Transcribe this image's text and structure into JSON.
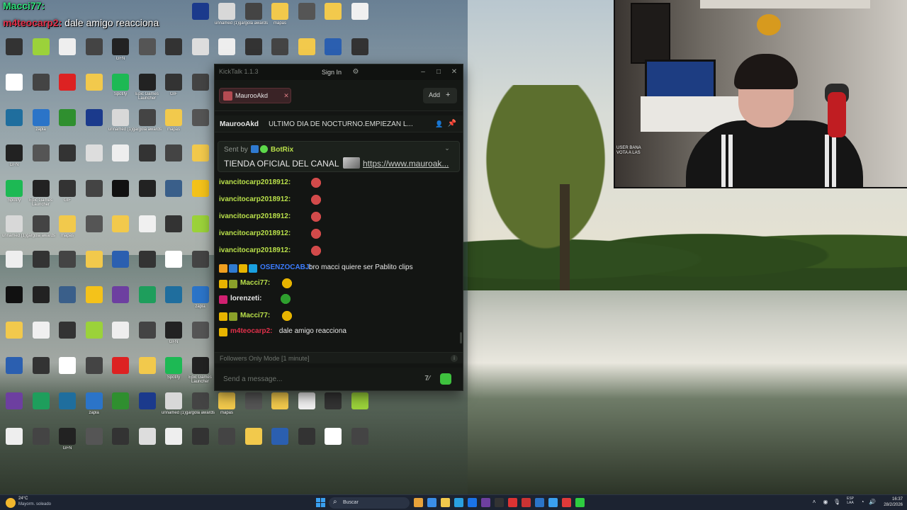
{
  "overlay_chat": [
    {
      "user": "Macci77:",
      "user_color": "#2ee07a",
      "text": ""
    },
    {
      "user": "m4teocarp2:",
      "user_color": "#e0304a",
      "text": "dale amigo reacciona"
    }
  ],
  "desktop_icons": [
    {
      "label": "",
      "color": "#3a5f8a"
    },
    {
      "label": "",
      "color": "#f4c21a"
    },
    {
      "label": "",
      "color": "#6d3fa0"
    },
    {
      "label": "",
      "color": "#1e9e5c"
    },
    {
      "label": "",
      "color": "#1f6e9e"
    },
    {
      "label": "zapla",
      "color": "#2b74c8"
    },
    {
      "label": "",
      "color": "#2f8f2f"
    },
    {
      "label": "",
      "color": "#1b3a8c"
    },
    {
      "label": "unnamed (1)",
      "color": "#d8d8d8"
    },
    {
      "label": "gargola awards",
      "color": "#444"
    },
    {
      "label": "mapas",
      "color": "#f2c94c"
    },
    {
      "label": "",
      "color": "#555"
    },
    {
      "label": "",
      "color": "#f2c94c"
    },
    {
      "label": "",
      "color": "#f0f0f0"
    },
    {
      "label": "",
      "color": "#333"
    },
    {
      "label": "",
      "color": "#9bd23a"
    },
    {
      "label": "",
      "color": "#eee"
    },
    {
      "label": "",
      "color": "#444"
    },
    {
      "label": "GFN",
      "color": "#222"
    },
    {
      "label": "",
      "color": "#555"
    },
    {
      "label": "",
      "color": "#333"
    },
    {
      "label": "",
      "color": "#ddd"
    },
    {
      "label": "",
      "color": "#eee"
    },
    {
      "label": "",
      "color": "#333"
    },
    {
      "label": "",
      "color": "#444"
    },
    {
      "label": "",
      "color": "#f2c94c"
    },
    {
      "label": "",
      "color": "#2b5fb0"
    },
    {
      "label": "",
      "color": "#333"
    },
    {
      "label": "",
      "color": "#fff"
    },
    {
      "label": "",
      "color": "#444"
    },
    {
      "label": "",
      "color": "#d22"
    },
    {
      "label": "",
      "color": "#f2c94c"
    },
    {
      "label": "Spotify",
      "color": "#1db954"
    },
    {
      "label": "Epic Games Launcher",
      "color": "#222"
    },
    {
      "label": "GIF",
      "color": "#333"
    },
    {
      "label": "",
      "color": "#444"
    },
    {
      "label": "",
      "color": "#111"
    },
    {
      "label": "",
      "color": "#222"
    }
  ],
  "kicktalk": {
    "app_title": "KickTalk 1.1.3",
    "signin_label": "Sign In",
    "settings_icon": "gear-icon",
    "tab_label": "MaurooAkd",
    "add_label": "Add",
    "channel_name": "MaurooAkd",
    "stream_title": "ULTIMO DIA DE NOCTURNO.EMPIEZAN L...",
    "pinned": {
      "sentby_label": "Sent by",
      "sender": "BotRix",
      "text": "TIENDA OFICIAL DEL CANAL",
      "link": "https://www.mauroak..."
    },
    "messages": [
      {
        "user": "ivancitocarp2018912:",
        "color": "#b9e04a",
        "text": "",
        "badges": [],
        "emote_color": "#d24a4a"
      },
      {
        "user": "ivancitocarp2018912:",
        "color": "#b9e04a",
        "text": "",
        "badges": [],
        "emote_color": "#d24a4a"
      },
      {
        "user": "ivancitocarp2018912:",
        "color": "#b9e04a",
        "text": "",
        "badges": [],
        "emote_color": "#d24a4a"
      },
      {
        "user": "ivancitocarp2018912:",
        "color": "#b9e04a",
        "text": "",
        "badges": [],
        "emote_color": "#d24a4a"
      },
      {
        "user": "ivancitocarp2018912:",
        "color": "#b9e04a",
        "text": "",
        "badges": [],
        "emote_color": "#d24a4a"
      },
      {
        "user": "OSENZOCABJ:",
        "color": "#3b7cff",
        "text": "bro macci quiere ser Pablito clips",
        "badges": [
          "#f0a020",
          "#2f7ad0",
          "#e7b400",
          "#1aa0e0"
        ],
        "emote_color": ""
      },
      {
        "user": "Macci77:",
        "color": "#b9e04a",
        "text": "",
        "badges": [
          "#e7b400",
          "#8aa02a"
        ],
        "emote_color": "#e7b400"
      },
      {
        "user": "lorenzeti:",
        "color": "#e8e8e8",
        "text": "",
        "badges": [
          "#d02070"
        ],
        "emote_color": "#2ea02e"
      },
      {
        "user": "Macci77:",
        "color": "#b9e04a",
        "text": "",
        "badges": [
          "#e7b400",
          "#8aa02a"
        ],
        "emote_color": "#e7b400"
      },
      {
        "user": "m4teocarp2:",
        "color": "#e0304a",
        "text": "dale amigo reacciona",
        "badges": [
          "#e7b400"
        ],
        "emote_color": ""
      }
    ],
    "followers_mode": "Followers Only Mode [1 minute]",
    "input_placeholder": "Send a message..."
  },
  "webcam_chat": [
    "USER BANA",
    "VOTA A LAS"
  ],
  "taskbar": {
    "weather_temp": "24°C",
    "weather_desc": "Mayorm. soleado",
    "search_label": "Buscar",
    "lang_line1": "ESP",
    "lang_line2": "LAA",
    "time": "16:37",
    "date": "28/2/2026",
    "apps": [
      "#e8a23a",
      "#3a8ee8",
      "#f2c94c",
      "#2aa0e0",
      "#1a73e8",
      "#6d3fa0",
      "#333",
      "#d33",
      "#c33",
      "#2b74c8",
      "#3aa0f0",
      "#e03a3a",
      "#2ecc40"
    ]
  }
}
